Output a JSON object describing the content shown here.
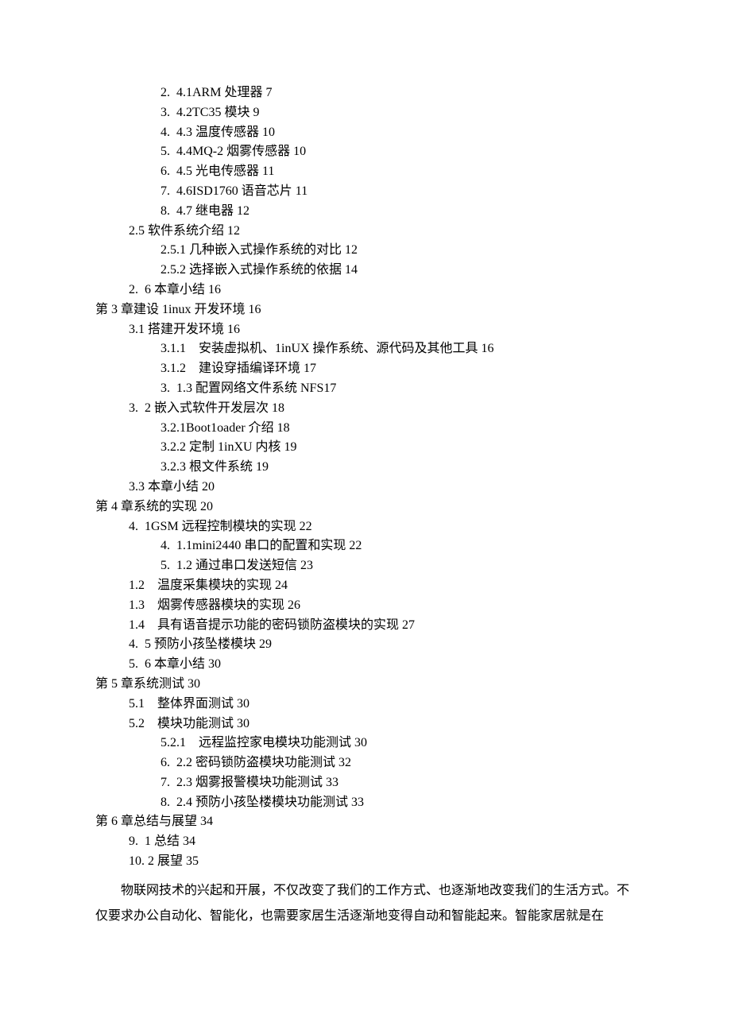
{
  "toc": [
    {
      "cls": "indent-2",
      "text": "2.  4.1ARM 处理器 7"
    },
    {
      "cls": "indent-2",
      "text": "3.  4.2TC35 模块 9"
    },
    {
      "cls": "indent-2",
      "text": "4.  4.3 温度传感器 10"
    },
    {
      "cls": "indent-2",
      "text": "5.  4.4MQ-2 烟雾传感器 10"
    },
    {
      "cls": "indent-2",
      "text": "6.  4.5 光电传感器 11"
    },
    {
      "cls": "indent-2",
      "text": "7.  4.6ISD1760 语音芯片 11"
    },
    {
      "cls": "indent-2",
      "text": "8.  4.7 继电器 12"
    },
    {
      "cls": "indent-1b",
      "text": "2.5 软件系统介绍 12"
    },
    {
      "cls": "indent-1c",
      "text": "2.5.1 几种嵌入式操作系统的对比 12"
    },
    {
      "cls": "indent-1c",
      "text": "2.5.2 选择嵌入式操作系统的依据 14"
    },
    {
      "cls": "indent-1b",
      "text": "2.  6 本章小结 16"
    },
    {
      "cls": "indent-0",
      "text": "第 3 章建设 1inux 开发环境 16"
    },
    {
      "cls": "indent-1b",
      "text": "3.1 搭建开发环境 16"
    },
    {
      "cls": "indent-2",
      "text": "3.1.1    安装虚拟机、1inUX 操作系统、源代码及其他工具 16"
    },
    {
      "cls": "indent-2",
      "text": "3.1.2    建设穿插编译环境 17"
    },
    {
      "cls": "indent-2",
      "text": "3.  1.3 配置网络文件系统 NFS17"
    },
    {
      "cls": "indent-1b",
      "text": "3.  2 嵌入式软件开发层次 18"
    },
    {
      "cls": "indent-1c",
      "text": "3.2.1Boot1oader 介绍 18"
    },
    {
      "cls": "indent-1c",
      "text": "3.2.2 定制 1inXU 内核 19"
    },
    {
      "cls": "indent-1c",
      "text": "3.2.3 根文件系统 19"
    },
    {
      "cls": "indent-1b",
      "text": "3.3 本章小结 20"
    },
    {
      "cls": "indent-0",
      "text": "第 4 章系统的实现 20"
    },
    {
      "cls": "indent-1b",
      "text": "4.  1GSM 远程控制模块的实现 22"
    },
    {
      "cls": "indent-2",
      "text": "4.  1.1mini2440 串口的配置和实现 22"
    },
    {
      "cls": "indent-2",
      "text": "5.  1.2 通过串口发送短信 23"
    },
    {
      "cls": "indent-1b",
      "text": "1.2    温度采集模块的实现 24"
    },
    {
      "cls": "indent-1b",
      "text": "1.3    烟雾传感器模块的实现 26"
    },
    {
      "cls": "indent-1b",
      "text": "1.4    具有语音提示功能的密码锁防盗模块的实现 27"
    },
    {
      "cls": "indent-1b",
      "text": "4.  5 预防小孩坠楼模块 29"
    },
    {
      "cls": "indent-1b",
      "text": "5.  6 本章小结 30"
    },
    {
      "cls": "indent-0",
      "text": "第 5 章系统测试 30"
    },
    {
      "cls": "indent-1b",
      "text": "5.1    整体界面测试 30"
    },
    {
      "cls": "indent-1b",
      "text": "5.2    模块功能测试 30"
    },
    {
      "cls": "indent-2",
      "text": "5.2.1    远程监控家电模块功能测试 30"
    },
    {
      "cls": "indent-2",
      "text": "6.  2.2 密码锁防盗模块功能测试 32"
    },
    {
      "cls": "indent-2",
      "text": "7.  2.3 烟雾报警模块功能测试 33"
    },
    {
      "cls": "indent-2",
      "text": "8.  2.4 预防小孩坠楼模块功能测试 33"
    },
    {
      "cls": "indent-0",
      "text": "第 6 章总结与展望 34"
    },
    {
      "cls": "indent-1b",
      "text": "9.  1 总结 34"
    },
    {
      "cls": "indent-1b",
      "text": "10. 2 展望 35"
    }
  ],
  "paragraph": "物联网技术的兴起和开展，不仅改变了我们的工作方式、也逐渐地改变我们的生活方式。不仅要求办公自动化、智能化，也需要家居生活逐渐地变得自动和智能起来。智能家居就是在"
}
